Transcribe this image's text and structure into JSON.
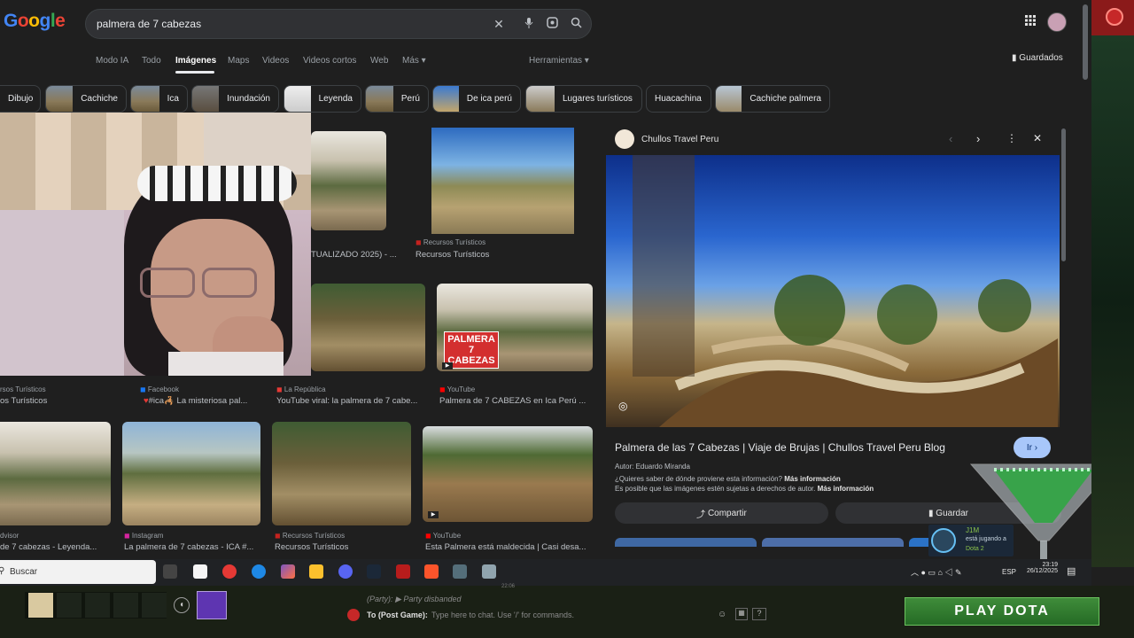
{
  "header": {
    "logo": "Google",
    "search_value": "palmera de 7 cabezas",
    "saved_label": "Guardados",
    "tools_label": "Herramientas",
    "tabs": [
      {
        "label": "Modo IA"
      },
      {
        "label": "Todo"
      },
      {
        "label": "Imágenes"
      },
      {
        "label": "Maps"
      },
      {
        "label": "Videos"
      },
      {
        "label": "Videos cortos"
      },
      {
        "label": "Web"
      },
      {
        "label": "Más"
      }
    ]
  },
  "chips": [
    {
      "label": "Dibujo"
    },
    {
      "label": "Cachiche"
    },
    {
      "label": "Ica"
    },
    {
      "label": "Inundación"
    },
    {
      "label": "Leyenda"
    },
    {
      "label": "Perú"
    },
    {
      "label": "De ica perú"
    },
    {
      "label": "Lugares turísticos"
    },
    {
      "label": "Huacachina"
    },
    {
      "label": "Cachiche palmera"
    }
  ],
  "results": [
    {
      "source": "",
      "title": "TUALIZADO 2025) - ..."
    },
    {
      "source": "Recursos Turísticos",
      "title": "Recursos Turísticos"
    },
    {
      "source": "rsos Turísticos",
      "title": "os Turísticos"
    },
    {
      "source": "Facebook",
      "title": "#ica🦂 La misteriosa pal..."
    },
    {
      "source": "La República",
      "title": "YouTube viral: la palmera de 7 cabe..."
    },
    {
      "source": "YouTube",
      "title": "Palmera de 7 CABEZAS en Ica Perú ..."
    },
    {
      "source": "dvisor",
      "title": "de 7 cabezas - Leyenda..."
    },
    {
      "source": "Instagram",
      "title": "La palmera de 7 cabezas - ICA #..."
    },
    {
      "source": "Recursos Turísticos",
      "title": "Recursos Turísticos"
    },
    {
      "source": "YouTube",
      "title": "Esta Palmera está maldecida | Casi desa..."
    }
  ],
  "thumb_overlay_text": "PALMERA 7 CABEZAS",
  "panel": {
    "site": "Chullos Travel Peru",
    "title": "Palmera de las 7 Cabezas | Viaje de Brujas | Chullos Travel Peru Blog",
    "go_label": "Ir",
    "author": "Autor: Eduardo Miranda",
    "info_q": "¿Quieres saber de dónde proviene esta información?",
    "info_more": "Más información",
    "rights": "Es posible que las imágenes estén sujetas a derechos de autor.",
    "rights_more": "Más información",
    "share_label": "Compartir",
    "save_label": "Guardar"
  },
  "taskbar": {
    "search_placeholder": "Buscar",
    "lang": "ESP",
    "time": "23:19",
    "date": "26/12/2025"
  },
  "steam_notice": {
    "name": "J1M",
    "status": "está jugando a",
    "game": "Dota 2"
  },
  "dota": {
    "party_line": "(Party): ▶ Party disbanded",
    "chat_prefix": "To (Post Game):",
    "chat_placeholder": "Type here to chat. Use '/' for commands.",
    "clock": "22:06",
    "play_label": "PLAY DOTA",
    "help": "?"
  },
  "colors": {
    "bg": "#1f1f1f",
    "search_bg": "#303134",
    "play_green": "#3f8c3a",
    "go_button": "#a8c7fa"
  }
}
